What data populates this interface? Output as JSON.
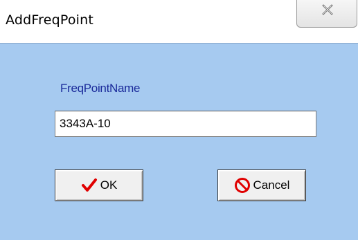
{
  "window": {
    "title": "AddFreqPoint"
  },
  "form": {
    "label": "FreqPointName",
    "input_value": "3343A-10"
  },
  "buttons": {
    "ok_label": "OK",
    "cancel_label": "Cancel"
  },
  "icons": {
    "close": "close-icon",
    "ok": "checkmark-icon",
    "cancel": "prohibited-icon"
  },
  "colors": {
    "client_background": "#a6caf0",
    "label_text": "#1a2a9a",
    "checkmark": "#e00000",
    "prohibited": "#e00000"
  }
}
